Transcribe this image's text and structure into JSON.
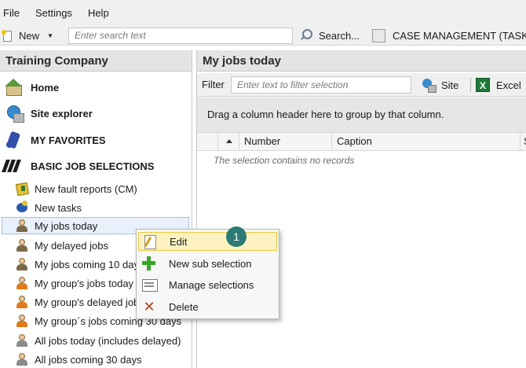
{
  "menubar": {
    "items": [
      "File",
      "Settings",
      "Help"
    ]
  },
  "toolbar": {
    "new_label": "New",
    "search_placeholder": "Enter search text",
    "search_button": "Search...",
    "case_management": "CASE MANAGEMENT (TASKS)"
  },
  "left_pane": {
    "title": "Training Company",
    "main_nav": [
      {
        "label": "Home",
        "icon": "home-icon"
      },
      {
        "label": "Site explorer",
        "icon": "site-explorer-icon"
      },
      {
        "label": "MY FAVORITES",
        "icon": "favorites-icon"
      },
      {
        "label": "BASIC JOB SELECTIONS",
        "icon": "job-selections-icon"
      }
    ],
    "tree_items": [
      {
        "label": "New fault reports (CM)",
        "icon": "fault-report-icon"
      },
      {
        "label": "New tasks",
        "icon": "new-task-icon"
      },
      {
        "label": "My jobs today",
        "icon": "person-icon",
        "selected": true
      },
      {
        "label": "My delayed jobs",
        "icon": "person-icon"
      },
      {
        "label": "My jobs coming 10 days",
        "icon": "person-icon"
      },
      {
        "label": "My group's jobs today",
        "icon": "group-icon"
      },
      {
        "label": "My group's delayed jobs",
        "icon": "group-icon"
      },
      {
        "label": "My group´s jobs coming 30 days",
        "icon": "group-icon"
      },
      {
        "label": "All jobs today (includes delayed)",
        "icon": "all-jobs-icon"
      },
      {
        "label": "All jobs coming 30 days",
        "icon": "all-jobs-icon"
      }
    ]
  },
  "right_pane": {
    "title": "My jobs today",
    "filter_label": "Filter",
    "filter_placeholder": "Enter text to filter selection",
    "site_button": "Site",
    "excel_button": "Excel",
    "group_hint": "Drag a column header here to group by that column.",
    "columns": [
      "Number",
      "Caption",
      "S"
    ],
    "empty_message": "The selection contains no records"
  },
  "context_menu": {
    "items": [
      {
        "label": "Edit",
        "icon": "edit-icon",
        "highlighted": true
      },
      {
        "label": "New sub selection",
        "icon": "add-icon"
      },
      {
        "label": "Manage selections",
        "icon": "manage-icon"
      },
      {
        "label": "Delete",
        "icon": "delete-icon"
      }
    ]
  },
  "callout": {
    "number": "1",
    "color": "#2c7a74"
  }
}
